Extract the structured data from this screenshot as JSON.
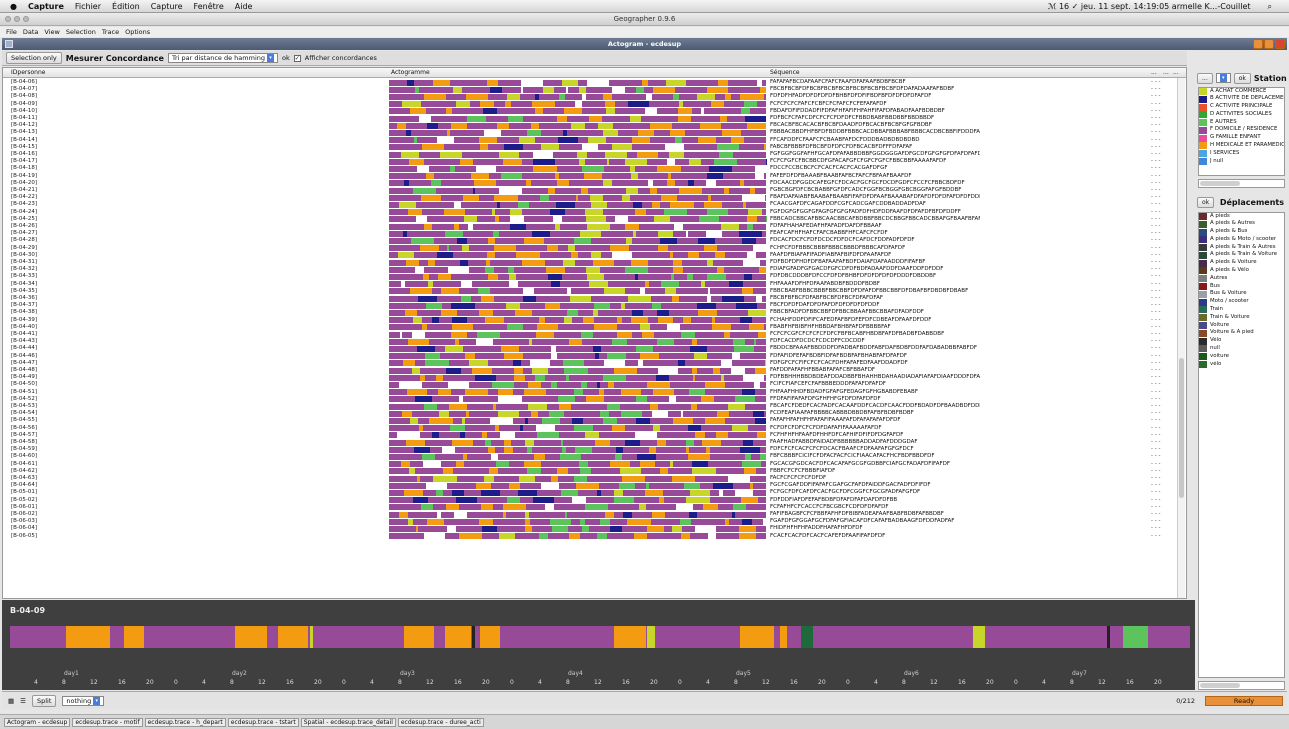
{
  "mac_menu": {
    "app": "Capture",
    "items": [
      "Fichier",
      "Édition",
      "Capture",
      "Fenêtre",
      "Aide"
    ],
    "right": "ℳ 16  ✓  jeu. 11 sept. 14:19:05  armelle K...-Couillet"
  },
  "window_title": "Geographer 0.9.6",
  "app_menu": [
    "File",
    "Data",
    "View",
    "Selection",
    "Trace",
    "Options"
  ],
  "frame_title": "Actogram - ecdesup",
  "toolbar": {
    "selection_only": "Selection only",
    "mesurer": "Mesurer Concordance",
    "sort": "Tri par distance de hamming",
    "ok": "ok",
    "afficher": "Afficher concordances"
  },
  "table_headers": {
    "id": "IDpersonne",
    "acto": "Actogramme",
    "seq": "Séquence",
    "c1": "...",
    "c2": "...",
    "c3": "..."
  },
  "rows": [
    {
      "id": "[B-04-06]",
      "seq": "FAFAFAFBCDAFAAFCFAFCFAAFDFAFAAFBDBFBCBF"
    },
    {
      "id": "[B-04-07]",
      "seq": "FBCBFBCBFDFBCBFBCBFBCBFBCBFBCBFBCBFDFDAFADAAFAFBDBF"
    },
    {
      "id": "[B-04-08]",
      "seq": "FDFDFHFADFDFDFDFDFBHBFDFDFIFBDFBFDFDFDFDFAFDF"
    },
    {
      "id": "[B-04-09]",
      "seq": "FCFCFCFCFAFCFCBFCFCFAFCFCFEFAFAFDF"
    },
    {
      "id": "[B-04-10]",
      "seq": "FBDAFDFIFDDADFIFDFAFHFAFIFHFAHFIFAFDFABADFAAFBDBDBF"
    },
    {
      "id": "[B-04-11]",
      "seq": "FDFBCFCFAFCDFCFCFCFDFDFCFBBDBABFBBDBBFBBDBBDF"
    },
    {
      "id": "[B-04-12]",
      "seq": "FBCACBFBCACACBFBCBFDAADFDFBCACBFBCBFGFGFBDBF"
    },
    {
      "id": "[B-04-13]",
      "seq": "FBBBACBBDFHFBFDFBDDBFBBBCACDBBAFBBBABFBBBCACDBCBBFIFDDDFADFAFADDDDDBDF"
    },
    {
      "id": "[B-04-14]",
      "seq": "FFCAFDDFCFAAFCFCBAABFAFDCFDDDBADBDBDBDBD"
    },
    {
      "id": "[B-04-15]",
      "seq": "FABCBFBBBFDFBCBFDFDFCFDFBCACBFDFFFDFAFAF"
    },
    {
      "id": "[B-04-16]",
      "seq": "FGFGGFGGFAFHFGCAFDFAFABBDBBFGGDGGGAFDFGCDFGFGFGFDFAFDFAFDFAAFDF"
    },
    {
      "id": "[B-04-17]",
      "seq": "FCFCFGFCFBCBBCDFGFACAFGFCFGFCFGFCFBBCBBFAAAAFAFDF"
    },
    {
      "id": "[B-04-18]",
      "seq": "FDCCFCCBCBCFCFCACFCACFCACGAFDFGF"
    },
    {
      "id": "[B-04-19]",
      "seq": "FAFEFDFDFBAAABFBAABFAFBCFAFCFBFAAFBAAFDF"
    },
    {
      "id": "[B-04-20]",
      "seq": "FDCAACDFGGDCAFEGFCFDCACFGCFGCFDCDFGDFCFCCFCFBBCBDFDF"
    },
    {
      "id": "[B-04-21]",
      "seq": "FGBCBGFDFCBCBABBFGFDFCADCFGGFBCBGGFGBCBGGFAFGFBDDBF"
    },
    {
      "id": "[B-04-22]",
      "seq": "FBAFDAFAIABFBAABAFBAABFIFAFDFDFAAFBAAABAFDFAFDFDFDFAFDFDFDDF"
    },
    {
      "id": "[B-04-23]",
      "seq": "FCAACGAFDFCAGAFDDFCGFCADCGAFCDDBADDADFDAF"
    },
    {
      "id": "[B-04-24]",
      "seq": "FGFDGFGFGGFGFAGFGFGFGFADFDFHDFDDFAAFDFDFAFDFBFDFDDFF"
    },
    {
      "id": "[B-04-25]",
      "seq": "FBBCADCBBCAFBBCAACBBCAFBDBBFBBCDCBBGFBBCADCBBAFGFBAAFBFAFGDFBADBFD"
    },
    {
      "id": "[B-04-26]",
      "seq": "FDFAFHAHAFEDAFHFAFADFDAFDFBBAAF"
    },
    {
      "id": "[B-04-27]",
      "seq": "FEAFCAFHFHAFCFAFCBABBFHFCAFCFCFDF"
    },
    {
      "id": "[B-04-28]",
      "seq": "FDCACFDCFCFDFDCDCFDFDCFCAFDCFDDFADFDFDF"
    },
    {
      "id": "[B-04-29]",
      "seq": "FCHFCFDFBBBCBBBFBBBCBBBDFBBBCAFDFAFDF"
    },
    {
      "id": "[B-04-30]",
      "seq": "FAAFDFBIAFAFIFADFIABFAFBIFDFDFAAFAFDF"
    },
    {
      "id": "[B-04-31]",
      "seq": "FDFBDFDFHDFDFBAFAAFAFBDFDAIAFDAFAADDDFIFAFBF"
    },
    {
      "id": "[B-04-32]",
      "seq": "FDIAFGFADFGFGACDFGFCDFDFBDFADAAFDDFDAAFDDFDFDDF"
    },
    {
      "id": "[B-04-33]",
      "seq": "FDFDBCDDDBFDFCCFDFDFBHBFDFDFDFDFDFDDDFDBDDBF"
    },
    {
      "id": "[B-04-34]",
      "seq": "FHFAAAFDFHFDFAAFABDBFBDDDFBDBF"
    },
    {
      "id": "[B-04-35]",
      "seq": "FBBCBABFBBBCBBBFBBCBBFDFDFAFDFBBCBBFDFDBAFBFDBDBFDBABF"
    },
    {
      "id": "[B-04-36]",
      "seq": "FBCBFBFBCFDFABFBCBFDFBCFDFAFDFAF"
    },
    {
      "id": "[B-04-37]",
      "seq": "FBCFDFDFDAFDFDFAFDFDFDFDFDFDDF"
    },
    {
      "id": "[B-04-38]",
      "seq": "FBBCBFADFDFBBCBBFDFBBCBBAAFBBCBBAFDFADFDDF"
    },
    {
      "id": "[B-04-39]",
      "seq": "FCHAHFDDFDFIFCAFEDFAFBFDFEFDFCDBEAFDFAAFDFDDF"
    },
    {
      "id": "[B-04-40]",
      "seq": "FBABFHFBIBFHFHBBDAFBHBFAFDFBBBBFAF"
    },
    {
      "id": "[B-04-41]",
      "seq": "FCFCFCGFCFCFCFCFDFCFBFBCABFHBDBFAFDFBADBFDABBDBF"
    },
    {
      "id": "[B-04-43]",
      "seq": "FDFCACDFDCDCFCDCDFFCDCDDF"
    },
    {
      "id": "[B-04-44]",
      "seq": "FBDDCBFAAAFBBDDDFDFADBAFBDDFABFDAFBDBFDDFAFDABADBBFABFDF"
    },
    {
      "id": "[B-04-46]",
      "seq": "FDFAFIDFEFAFBDBFIDFAFBDBFAFBHABFAFDFAFDF"
    },
    {
      "id": "[B-04-47]",
      "seq": "FDFGFCFCFIFCFCFCACFDHFAFAFEDFAAFDDADFDF"
    },
    {
      "id": "[B-04-48]",
      "seq": "FAFDDFAFAFHFBBABFAFAFCBFBBAFDF"
    },
    {
      "id": "[B-04-49]",
      "seq": "FDFBBHHHBBDBDEAFDDADBBFBHAHHBDAHAADIADAFIAFAFDIAAFDDDFDFAHADFDDDIDF"
    },
    {
      "id": "[B-04-50]",
      "seq": "FCIFCFIAFCEFCFAFBBBEDDDFAFAFDFAFDF"
    },
    {
      "id": "[B-04-51]",
      "seq": "FHFAAFHHDFBDADFGFAFGFEDAGFGFHGBABDFEBABF"
    },
    {
      "id": "[B-04-52]",
      "seq": "FFDFAFIFAFAFDFGFHFHFGFDFDFAFDFDF"
    },
    {
      "id": "[B-04-53]",
      "seq": "FBCAFCFDEDFCACFADFCACAAFDDFCACDFCAACFDDFBDADFDFBAADBDFDDDF"
    },
    {
      "id": "[B-04-54]",
      "seq": "FCDFEAFIAAFAFBBBBCABBBDBBDBFAFBFBDBFBDBF"
    },
    {
      "id": "[B-04-55]",
      "seq": "FAFAFHFAFHFHFAFAFIFAAAFAFDFAFAFAFAFDFDF"
    },
    {
      "id": "[B-04-56]",
      "seq": "FCFDFCFDFCFCFDFDAFAFIFAAAAAFAFDF"
    },
    {
      "id": "[B-04-57]",
      "seq": "FCFHFHFHFAAFDFHHFDFCAFHIFDFIFDFDGFAFDF"
    },
    {
      "id": "[B-04-58]",
      "seq": "FAAFHADFABBDFAIDADFBBBBBBADDADFAFDDDGDAF"
    },
    {
      "id": "[B-04-59]",
      "seq": "FDFCFCFCACFCFCFDCACFBAAFCFDFAAFAFGFGFDCF"
    },
    {
      "id": "[B-04-60]",
      "seq": "FBFCBBBFCICIFCFDFACFACFCICFIAACAFACFHCFBDFBBDFDF"
    },
    {
      "id": "[B-04-61]",
      "seq": "FGCACGFGDCACFDFCACAFAFGCGFGDBBFCIAFGCFADAFDFIFAFDF"
    },
    {
      "id": "[B-04-62]",
      "seq": "FBBFCFCFCFBBBFIAFDF"
    },
    {
      "id": "[B-04-63]",
      "seq": "FACFCFCFCFCFDFDF"
    },
    {
      "id": "[B-04-64]",
      "seq": "FGCFCGAFDDFIFAFAFCGAFGCFAFDFAIDDFGACFADFDFIFDF"
    },
    {
      "id": "[B-05-01]",
      "seq": "FCFGCFDFCAFDFCACFGCFDFCGGFCFGCGFADFAFGFDF"
    },
    {
      "id": "[B-05-02]",
      "seq": "FDFDDFIAFDFEFAFBDBFDFAFDFAFDAFDFDFBB"
    },
    {
      "id": "[B-06-01]",
      "seq": "FCFAFHFCFCACCFCFBCGBCFCDFDFDFAFDF"
    },
    {
      "id": "[B-06-02]",
      "seq": "FAFIFBAGBFCFCFBBFAFHFDFBIBFADEAFAAFBABFBDBFAFBBDBF"
    },
    {
      "id": "[B-06-03]",
      "seq": "FGAFDFGFGGAFGCFDFAFGFIACAFDFCAFAFBADBAAGFDFDDFADFAF"
    },
    {
      "id": "[B-06-04]",
      "seq": "FHIDFHFHFHFADDFHAFAFHFDFDF"
    },
    {
      "id": "[B-06-05]",
      "seq": "FCACFCACFDFCACFCAFEFDFAAFIFAFDFDF"
    }
  ],
  "dash": "-    -    -",
  "detail": {
    "label": "B-04-09",
    "days": [
      "day1",
      "day2",
      "day3",
      "day4",
      "day5",
      "day6",
      "day7"
    ],
    "hours": [
      "4",
      "8",
      "12",
      "16",
      "20",
      "0"
    ]
  },
  "bottom": {
    "split": "Split",
    "nothing": "nothing",
    "count": "0/212",
    "ready": "Ready"
  },
  "tabs": [
    "Actogram - ecdesup",
    "ecdesup.trace - motif",
    "ecdesup.trace - h_depart",
    "ecdesup.trace - tstart",
    "Spatial - ecdesup.trace_detail",
    "ecdesup.trace - duree_acti"
  ],
  "station": {
    "title": "Station",
    "ok": "ok",
    "items": [
      {
        "label": "A ACHAT COMMERCE",
        "color": "#c8d62a"
      },
      {
        "label": "B ACTIVITE DE DEPLACEMENT",
        "color": "#1c1c8a"
      },
      {
        "label": "C ACTIVITE PRINCIPALE",
        "color": "#e8532a"
      },
      {
        "label": "D ACTIVITES SOCIALES",
        "color": "#2fa82f"
      },
      {
        "label": "E AUTRES",
        "color": "#5dc35d"
      },
      {
        "label": "F DOMICILE / RESIDENCE",
        "color": "#974a98"
      },
      {
        "label": "G FAMILLE ENFANT",
        "color": "#ea4aa0"
      },
      {
        "label": "H MEDICALE ET PARAMEDICAL",
        "color": "#f39c12"
      },
      {
        "label": "I SERVICES",
        "color": "#4aa6e0"
      },
      {
        "label": "J null",
        "color": "#3f87d8"
      }
    ]
  },
  "deplacements": {
    "title": "Déplacements",
    "ok": "ok",
    "items": [
      {
        "label": "A pieds",
        "color": "#6b2a2a"
      },
      {
        "label": "A pieds & Autres",
        "color": "#3b5e2b"
      },
      {
        "label": "A pieds & Bus",
        "color": "#2b4a7d"
      },
      {
        "label": "A pieds & Moto / scooter",
        "color": "#3b2e7d"
      },
      {
        "label": "A pieds & Train & Autres",
        "color": "#3a3a3a"
      },
      {
        "label": "A pieds & Train & Voiture",
        "color": "#2a4a3a"
      },
      {
        "label": "A pieds & Voiture",
        "color": "#4a2a4a"
      },
      {
        "label": "A pieds & Vélo",
        "color": "#5a3a1a"
      },
      {
        "label": "Autres",
        "color": "#7d7d7d"
      },
      {
        "label": "Bus",
        "color": "#8a1a1a"
      },
      {
        "label": "Bus & Voiture",
        "color": "#9aa0a8"
      },
      {
        "label": "Moto / scooter",
        "color": "#2a3a8a"
      },
      {
        "label": "Train",
        "color": "#2a6a5a"
      },
      {
        "label": "Train & Voiture",
        "color": "#6a6a2a"
      },
      {
        "label": "Voiture",
        "color": "#4a4a8a"
      },
      {
        "label": "Voiture & A pied",
        "color": "#8a4a2a"
      },
      {
        "label": "Vélo",
        "color": "#2a2a2a"
      },
      {
        "label": "null",
        "color": "#5a5a5a"
      },
      {
        "label": "voiture",
        "color": "#1a5a1a"
      },
      {
        "label": "vélo",
        "color": "#2a6a2a"
      }
    ]
  },
  "colors": {
    "home": "#974a98",
    "orange": "#f39c12",
    "green": "#5dc35d",
    "yellow": "#c8d62a",
    "navy": "#1c1c8a",
    "white": "#ffffff"
  }
}
